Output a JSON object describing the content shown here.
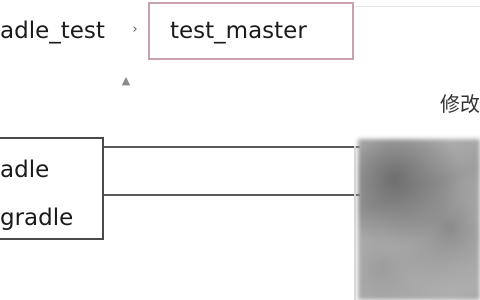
{
  "breadcrumb": {
    "parent": "adle_test",
    "separator": "›",
    "current": "test_master"
  },
  "list": {
    "sort_indicator": "▲",
    "modified_column": "修改"
  },
  "files": [
    {
      "name": "adle"
    },
    {
      "name": "gradle"
    }
  ],
  "colors": {
    "current_crumb_border": "#c9a3ab",
    "name_box_border": "#4a4a4a"
  }
}
